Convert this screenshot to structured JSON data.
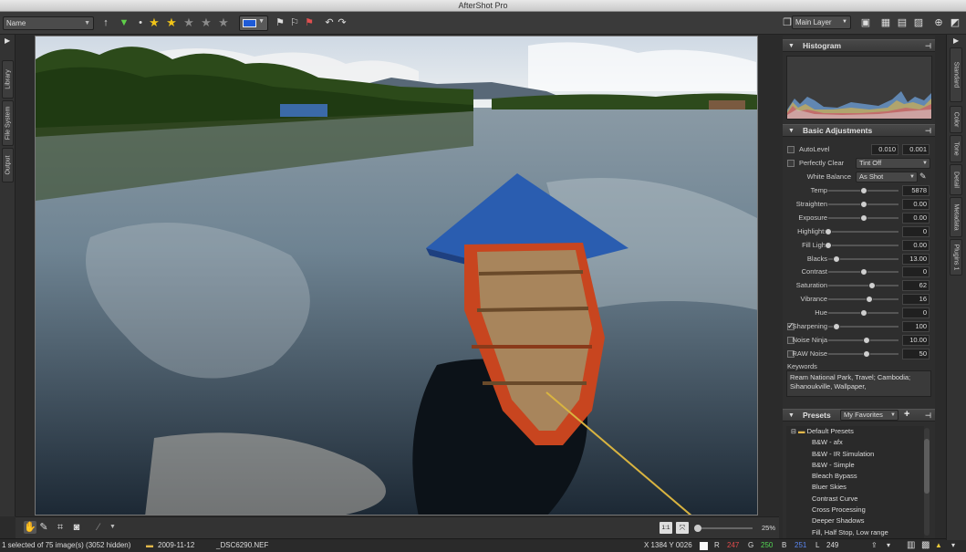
{
  "app": {
    "title": "AfterShot Pro"
  },
  "toolbar": {
    "sort_value": "Name",
    "layer_value": "Main Layer",
    "color_label_hex": "#1e5bd8",
    "rating_stars": 2,
    "rating_max": 5
  },
  "left_tabs": [
    "Library",
    "File System",
    "Output"
  ],
  "right_tabs": [
    "Standard",
    "Color",
    "Tone",
    "Detail",
    "Metadata",
    "Plugins 1"
  ],
  "histogram": {
    "title": "Histogram"
  },
  "basic": {
    "title": "Basic Adjustments",
    "autolevel": {
      "label": "AutoLevel",
      "v1": "0.010",
      "v2": "0.001"
    },
    "perfectly_clear": {
      "label": "Perfectly Clear",
      "value": "Tint Off"
    },
    "white_balance": {
      "label": "White Balance",
      "value": "As Shot"
    },
    "sliders": [
      {
        "label": "Temp",
        "value": "5878",
        "pos": 0.5
      },
      {
        "label": "Straighten",
        "value": "0.00",
        "pos": 0.5
      },
      {
        "label": "Exposure",
        "value": "0.00",
        "pos": 0.5
      },
      {
        "label": "Highlights",
        "value": "0",
        "pos": 0.0
      },
      {
        "label": "Fill Light",
        "value": "0.00",
        "pos": 0.0
      },
      {
        "label": "Blacks",
        "value": "13.00",
        "pos": 0.12
      },
      {
        "label": "Contrast",
        "value": "0",
        "pos": 0.5
      },
      {
        "label": "Saturation",
        "value": "62",
        "pos": 0.62
      },
      {
        "label": "Vibrance",
        "value": "16",
        "pos": 0.58
      },
      {
        "label": "Hue",
        "value": "0",
        "pos": 0.5
      },
      {
        "label": "Sharpening",
        "value": "100",
        "pos": 0.12
      },
      {
        "label": "Noise Ninja",
        "value": "10.00",
        "pos": 0.55
      },
      {
        "label": "RAW Noise",
        "value": "50",
        "pos": 0.55
      }
    ],
    "keywords_label": "Keywords",
    "keywords": "Ream National Park, Travel; Cambodia; Sihanoukville, Wallpaper,"
  },
  "presets": {
    "title": "Presets",
    "filter": "My Favorites",
    "folder": "Default Presets",
    "items": [
      "B&W - afx",
      "B&W - IR Simulation",
      "B&W - Simple",
      "Bleach Bypass",
      "Bluer Skies",
      "Contrast Curve",
      "Cross Processing",
      "Deeper Shadows",
      "Fill, Half Stop, Low range"
    ]
  },
  "bottom": {
    "zoom": "25%",
    "fit_label": "1:1"
  },
  "status": {
    "selection": "1 selected of 75 image(s) (3052 hidden)",
    "folder": "2009-11-12",
    "filename": "_DSC6290.NEF",
    "coords": "X 1384  Y 0026",
    "r_label": "R",
    "r": "247",
    "g_label": "G",
    "g": "250",
    "b_label": "B",
    "b": "251",
    "l_label": "L",
    "l": "249"
  }
}
